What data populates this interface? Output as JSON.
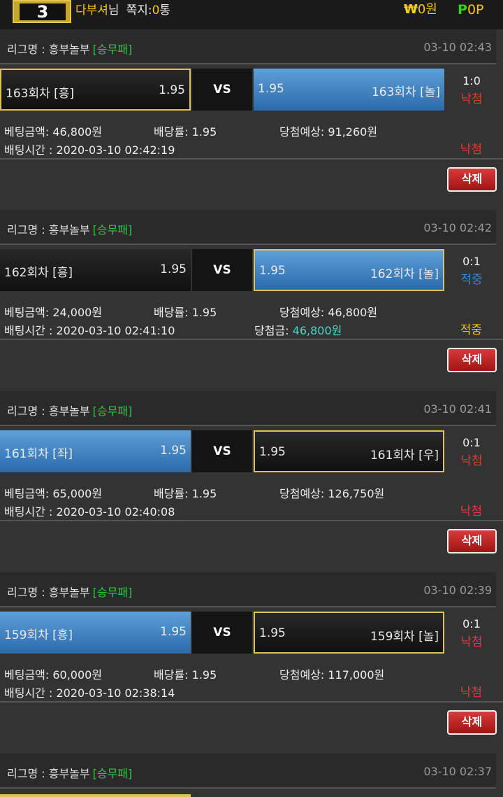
{
  "header": {
    "logo_text": "3",
    "nickname": "다부셔",
    "nickname_suffix": "님",
    "message_label": "쪽지:",
    "message_count": "0",
    "message_unit": "통",
    "money_symbol": "₩",
    "money_value": "0원",
    "point_symbol": "P",
    "point_value": "0P"
  },
  "labels": {
    "league_prefix": "리그명 : ",
    "bet_amount": "베팅금액: ",
    "odds": "배당률: ",
    "expected_win": "당첨예상: ",
    "bet_time": "배팅시간 : ",
    "won_amount": "당첨금: ",
    "vs": "VS",
    "delete": "삭제"
  },
  "bets": [
    {
      "league": "흥부놀부",
      "bet_type": "[승무패]",
      "time": "03-10 02:43",
      "home_team": "163회차 [흥]",
      "home_odds": "1.95",
      "away_team": "163회차 [놀]",
      "away_odds": "1.95",
      "score": "1:0",
      "game_result": "낙첨",
      "bet_amount": "46,800원",
      "odds": "1.95",
      "expected_win": "91,260원",
      "bet_time": "2020-03-10 02:42:19",
      "won_amount": "",
      "bet_result": "낙첨"
    },
    {
      "league": "흥부놀부",
      "bet_type": "[승무패]",
      "time": "03-10 02:42",
      "home_team": "162회차 [흥]",
      "home_odds": "1.95",
      "away_team": "162회차 [놀]",
      "away_odds": "1.95",
      "score": "0:1",
      "game_result": "적중",
      "bet_amount": "24,000원",
      "odds": "1.95",
      "expected_win": "46,800원",
      "bet_time": "2020-03-10 02:41:10",
      "won_amount": "46,800원",
      "bet_result": "적중"
    },
    {
      "league": "흥부놀부",
      "bet_type": "[승무패]",
      "time": "03-10 02:41",
      "home_team": "161회차 [좌]",
      "home_odds": "1.95",
      "away_team": "161회차 [우]",
      "away_odds": "1.95",
      "score": "0:1",
      "game_result": "낙첨",
      "bet_amount": "65,000원",
      "odds": "1.95",
      "expected_win": "126,750원",
      "bet_time": "2020-03-10 02:40:08",
      "won_amount": "",
      "bet_result": "낙첨"
    },
    {
      "league": "흥부놀부",
      "bet_type": "[승무패]",
      "time": "03-10 02:39",
      "home_team": "159회차 [흥]",
      "home_odds": "1.95",
      "away_team": "159회차 [놀]",
      "away_odds": "1.95",
      "score": "0:1",
      "game_result": "낙첨",
      "bet_amount": "60,000원",
      "odds": "1.95",
      "expected_win": "117,000원",
      "bet_time": "2020-03-10 02:38:14",
      "won_amount": "",
      "bet_result": "낙첨"
    },
    {
      "league": "흥부놀부",
      "bet_type": "[승무패]",
      "time": "03-10 02:37"
    }
  ],
  "colors": {
    "background": "#333333",
    "selected_team": "#3f82c4",
    "pick_border": "#e0c25a",
    "lose": "#e03a3a",
    "hit": "#2e8ed6",
    "bet_type": "#39c44a",
    "delete_button": "#c02828"
  }
}
